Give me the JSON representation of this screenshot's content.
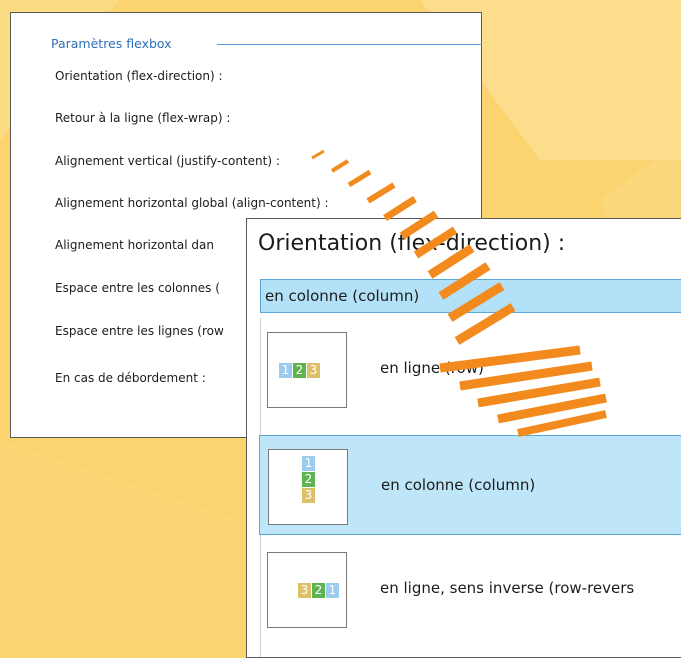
{
  "back_panel": {
    "legend": "Paramètres flexbox",
    "fields": [
      {
        "label": "Orientation (flex-direction) :"
      },
      {
        "label": "Retour à la ligne (flex-wrap) :"
      },
      {
        "label": "Alignement vertical (justify-content) :"
      },
      {
        "label": "Alignement horizontal global (align-content) :"
      },
      {
        "label": "Alignement horizontal dan"
      },
      {
        "label": "Espace entre les colonnes ("
      },
      {
        "label": "Espace entre les lignes (row"
      },
      {
        "label": "En cas de débordement :"
      }
    ]
  },
  "front_panel": {
    "title": "Orientation (flex-direction) :",
    "selected_value": "en colonne (column)",
    "options": [
      {
        "label": "en ligne (row)",
        "digits": [
          "1",
          "2",
          "3"
        ]
      },
      {
        "label": "en colonne (column)",
        "digits": [
          "1",
          "2",
          "3"
        ],
        "selected": true
      },
      {
        "label": "en ligne, sens inverse (row-revers",
        "digits": [
          "3",
          "2",
          "1"
        ]
      }
    ]
  },
  "colors": {
    "background": "#fbd36f",
    "arrow": "#f28a1e",
    "selection": "#bfe5f8",
    "blue_square": "#9ccbf0",
    "green_square": "#5eb44e",
    "yellow_square": "#dcc06a"
  },
  "icons": {
    "arrow": "curved-striped-arrow-icon"
  }
}
